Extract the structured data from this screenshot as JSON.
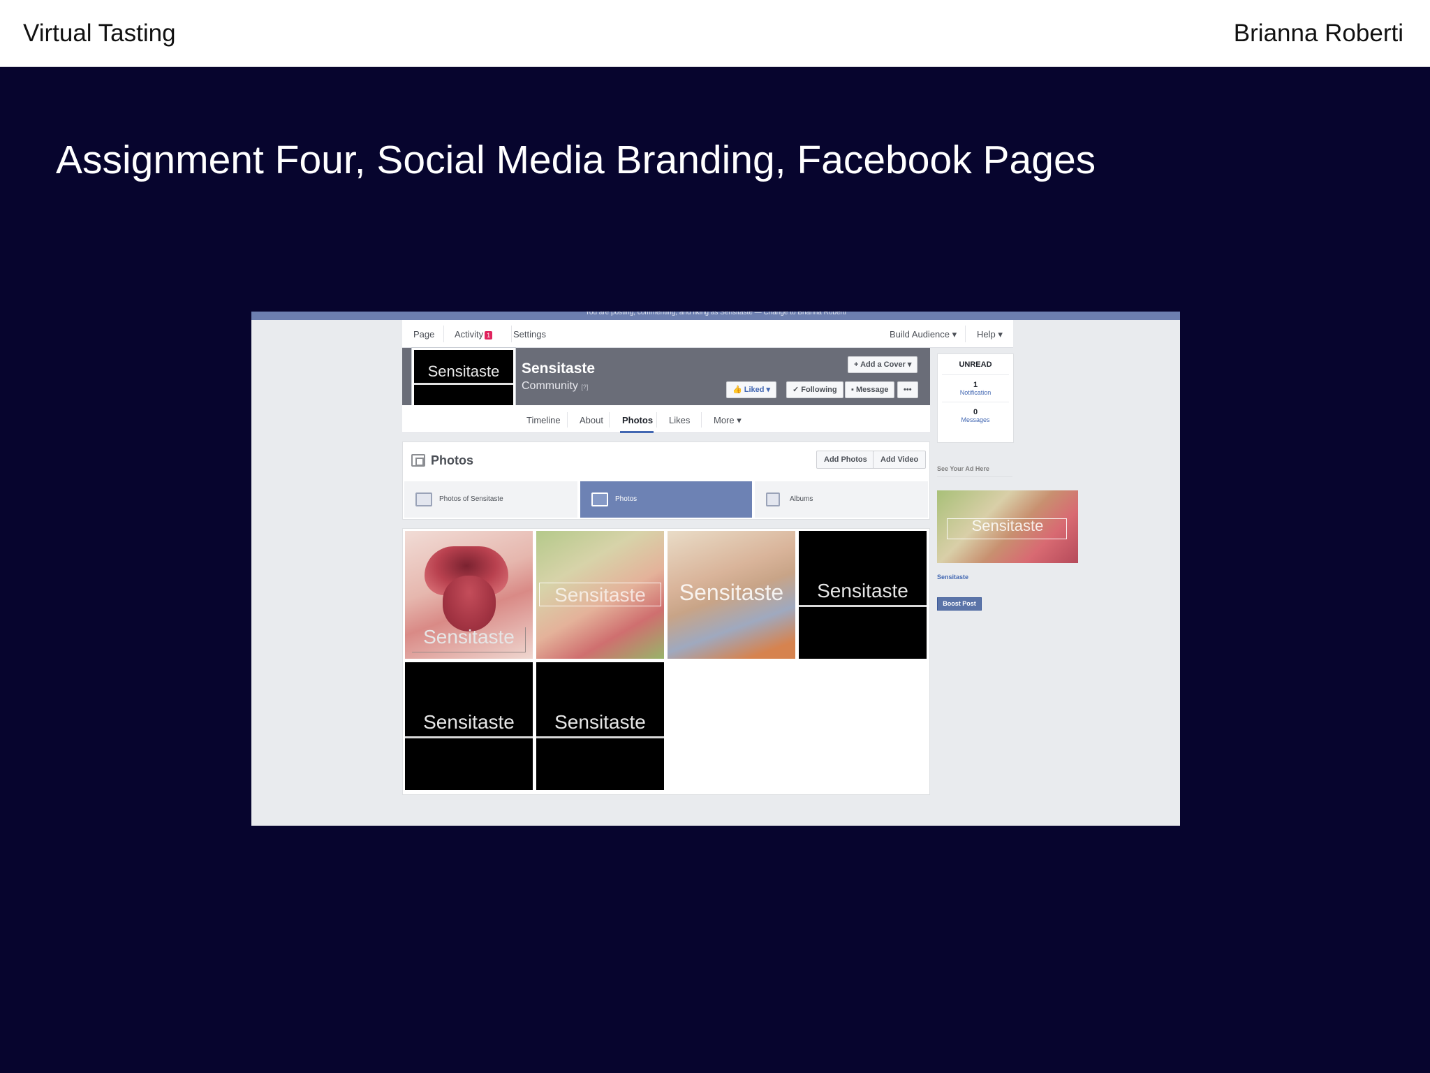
{
  "header": {
    "title": "Virtual Tasting",
    "author": "Brianna Roberti"
  },
  "slide": {
    "heading": "Assignment Four, Social Media Branding, Facebook Pages"
  },
  "facebook": {
    "posting_notice": "You are posting, commenting, and liking as Sensitaste — Change to Brianna Roberti",
    "admin_nav": {
      "page": "Page",
      "activity": "Activity",
      "activity_badge": "1",
      "settings": "Settings",
      "build_audience": "Build Audience ▾",
      "help": "Help ▾"
    },
    "profile": {
      "picture_text": "Sensitaste",
      "name": "Sensitaste",
      "category": "Community",
      "category_note": "[?]"
    },
    "cover_buttons": {
      "add_cover": "+ Add a Cover ▾",
      "liked": "Liked ▾",
      "following": "✓ Following",
      "message": "Message",
      "more": "•••"
    },
    "tabs": {
      "timeline": "Timeline",
      "about": "About",
      "photos": "Photos",
      "likes": "Likes",
      "more": "More ▾"
    },
    "unread": {
      "heading": "UNREAD",
      "notification_count": "1",
      "notification_label": "Notification",
      "messages_count": "0",
      "messages_label": "Messages"
    },
    "ad": {
      "label": "See Your Ad Here",
      "image_text": "Sensitaste",
      "page_name": "Sensitaste",
      "boost": "Boost Post"
    },
    "photos": {
      "title": "Photos",
      "add_photos": "Add Photos",
      "add_video": "Add Video",
      "subtabs": [
        "Photos of Sensitaste",
        "Photos",
        "Albums"
      ],
      "tiles": [
        "Sensitaste",
        "Sensitaste",
        "Sensitaste",
        "Sensitaste",
        "Sensitaste",
        "Sensitaste"
      ]
    }
  },
  "colors": {
    "slide_bg": "#07052e",
    "fb_blue": "#4267b2",
    "subtab_selected": "#6d82b4"
  }
}
